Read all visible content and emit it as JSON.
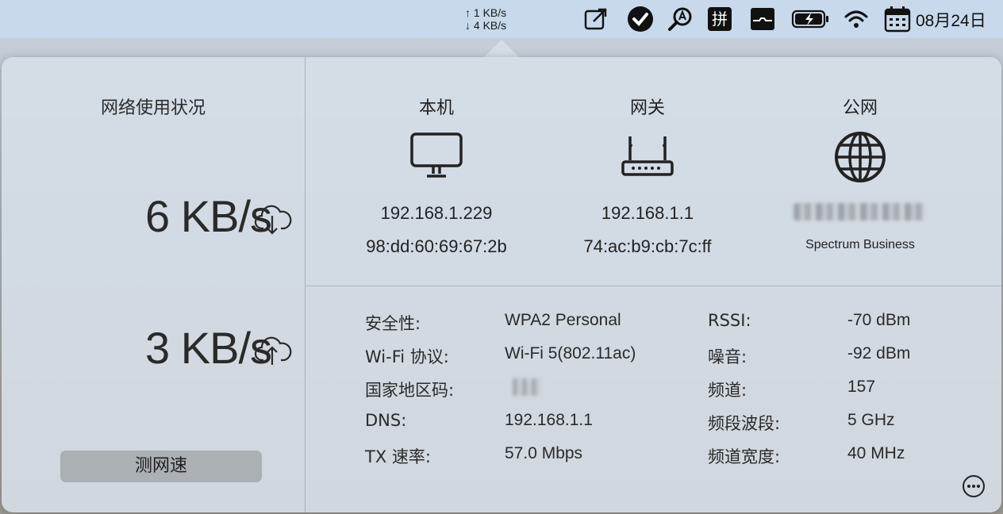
{
  "menubar": {
    "upload_speed": "↑ 1 KB/s",
    "download_speed": "↓ 4 KB/s",
    "icons": [
      "share-icon",
      "check-circle-icon",
      "search-app-icon",
      "pinyin-input-icon",
      "network-monitor-icon",
      "battery-charging-icon",
      "wifi-icon",
      "calendar-icon"
    ],
    "input_method_label": "拼",
    "date": "08月24日"
  },
  "left": {
    "title": "网络使用状况",
    "download_value": "6 KB/s",
    "upload_value": "3 KB/s",
    "speed_test_label": "测网速"
  },
  "devices": [
    {
      "title": "本机",
      "icon": "monitor-icon",
      "line1": "192.168.1.229",
      "line2": "98:dd:60:69:67:2b"
    },
    {
      "title": "网关",
      "icon": "router-icon",
      "line1": "192.168.1.1",
      "line2": "74:ac:b9:cb:7c:ff"
    },
    {
      "title": "公网",
      "icon": "globe-icon",
      "line1": "",
      "line2": "Spectrum Business"
    }
  ],
  "info_left": [
    {
      "label": "安全性:",
      "value": "WPA2 Personal"
    },
    {
      "label": "Wi-Fi 协议:",
      "value": "Wi-Fi 5(802.11ac)"
    },
    {
      "label": "国家地区码:",
      "value": ""
    },
    {
      "label": "DNS:",
      "value": "192.168.1.1"
    },
    {
      "label": "TX 速率:",
      "value": "57.0 Mbps"
    }
  ],
  "info_right": [
    {
      "label": "RSSI:",
      "value": "-70 dBm"
    },
    {
      "label": "噪音:",
      "value": "-92 dBm"
    },
    {
      "label": "频道:",
      "value": "157"
    },
    {
      "label": "频段波段:",
      "value": "5 GHz"
    },
    {
      "label": "频道宽度:",
      "value": "40 MHz"
    }
  ]
}
